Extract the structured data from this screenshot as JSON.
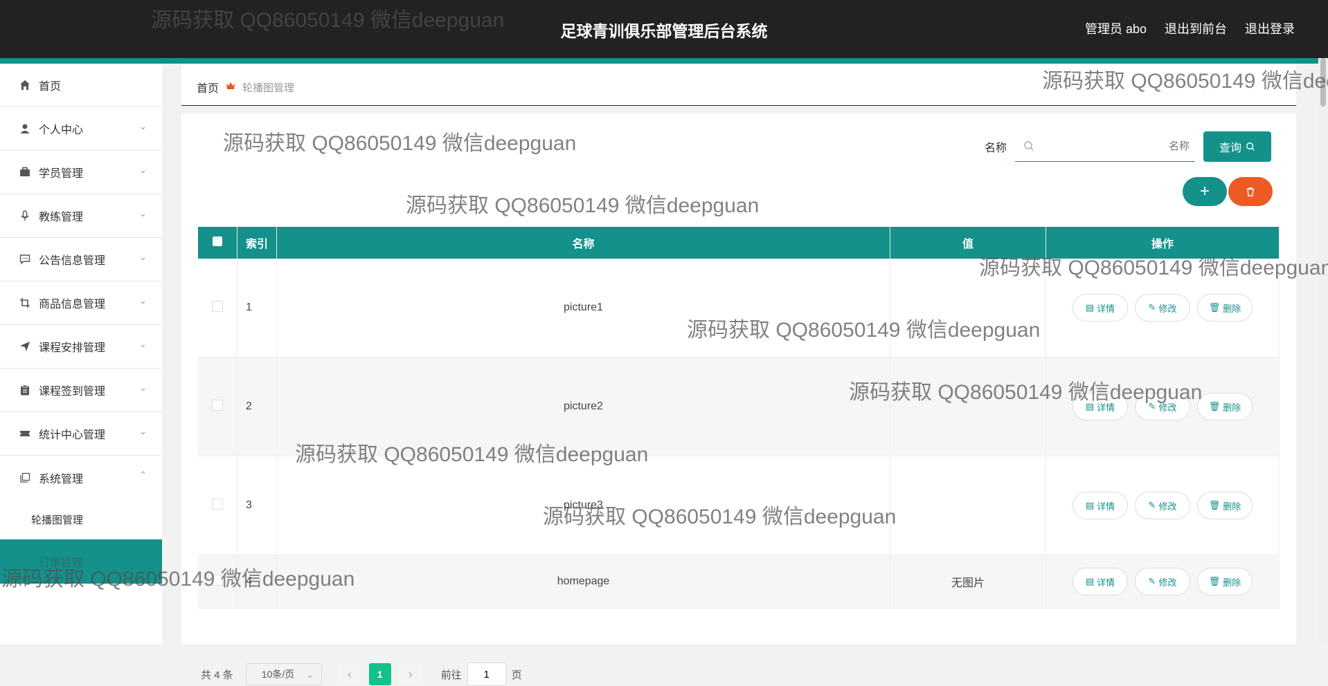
{
  "header": {
    "title": "足球青训俱乐部管理后台系统",
    "user": "管理员 abo",
    "to_front": "退出到前台",
    "logout": "退出登录"
  },
  "sidebar": {
    "items": [
      {
        "label": "首页",
        "icon": "home-icon"
      },
      {
        "label": "个人中心",
        "icon": "user-icon"
      },
      {
        "label": "学员管理",
        "icon": "briefcase-icon"
      },
      {
        "label": "教练管理",
        "icon": "microphone-icon"
      },
      {
        "label": "公告信息管理",
        "icon": "chat-icon"
      },
      {
        "label": "商品信息管理",
        "icon": "crop-icon"
      },
      {
        "label": "课程安排管理",
        "icon": "send-icon"
      },
      {
        "label": "课程签到管理",
        "icon": "clipboard-icon"
      },
      {
        "label": "统计中心管理",
        "icon": "ticket-icon"
      },
      {
        "label": "系统管理",
        "icon": "copy-icon"
      }
    ],
    "sub_item": "轮播图管理",
    "active_item": "订单管理"
  },
  "breadcrumb": {
    "home": "首页",
    "current": "轮播图管理"
  },
  "search": {
    "label": "名称",
    "placeholder": "名称",
    "button": "查询"
  },
  "table": {
    "headers": [
      "索引",
      "名称",
      "值",
      "操作"
    ],
    "rows": [
      {
        "index": "1",
        "name": "picture1",
        "value": ""
      },
      {
        "index": "2",
        "name": "picture2",
        "value": ""
      },
      {
        "index": "3",
        "name": "picture3",
        "value": ""
      },
      {
        "index": "4",
        "name": "homepage",
        "value": "无图片"
      }
    ],
    "actions": {
      "detail": "详情",
      "edit": "修改",
      "delete": "删除"
    }
  },
  "pagination": {
    "total": "共 4 条",
    "page_size": "10条/页",
    "current_page": "1",
    "goto_prefix": "前往",
    "goto_value": "1",
    "goto_suffix": "页"
  },
  "watermark": "源码获取 QQ86050149 微信deepguan",
  "colors": {
    "primary": "#13918a",
    "danger": "#ee5a24",
    "header": "#222222",
    "pager_active": "#13c18a"
  }
}
